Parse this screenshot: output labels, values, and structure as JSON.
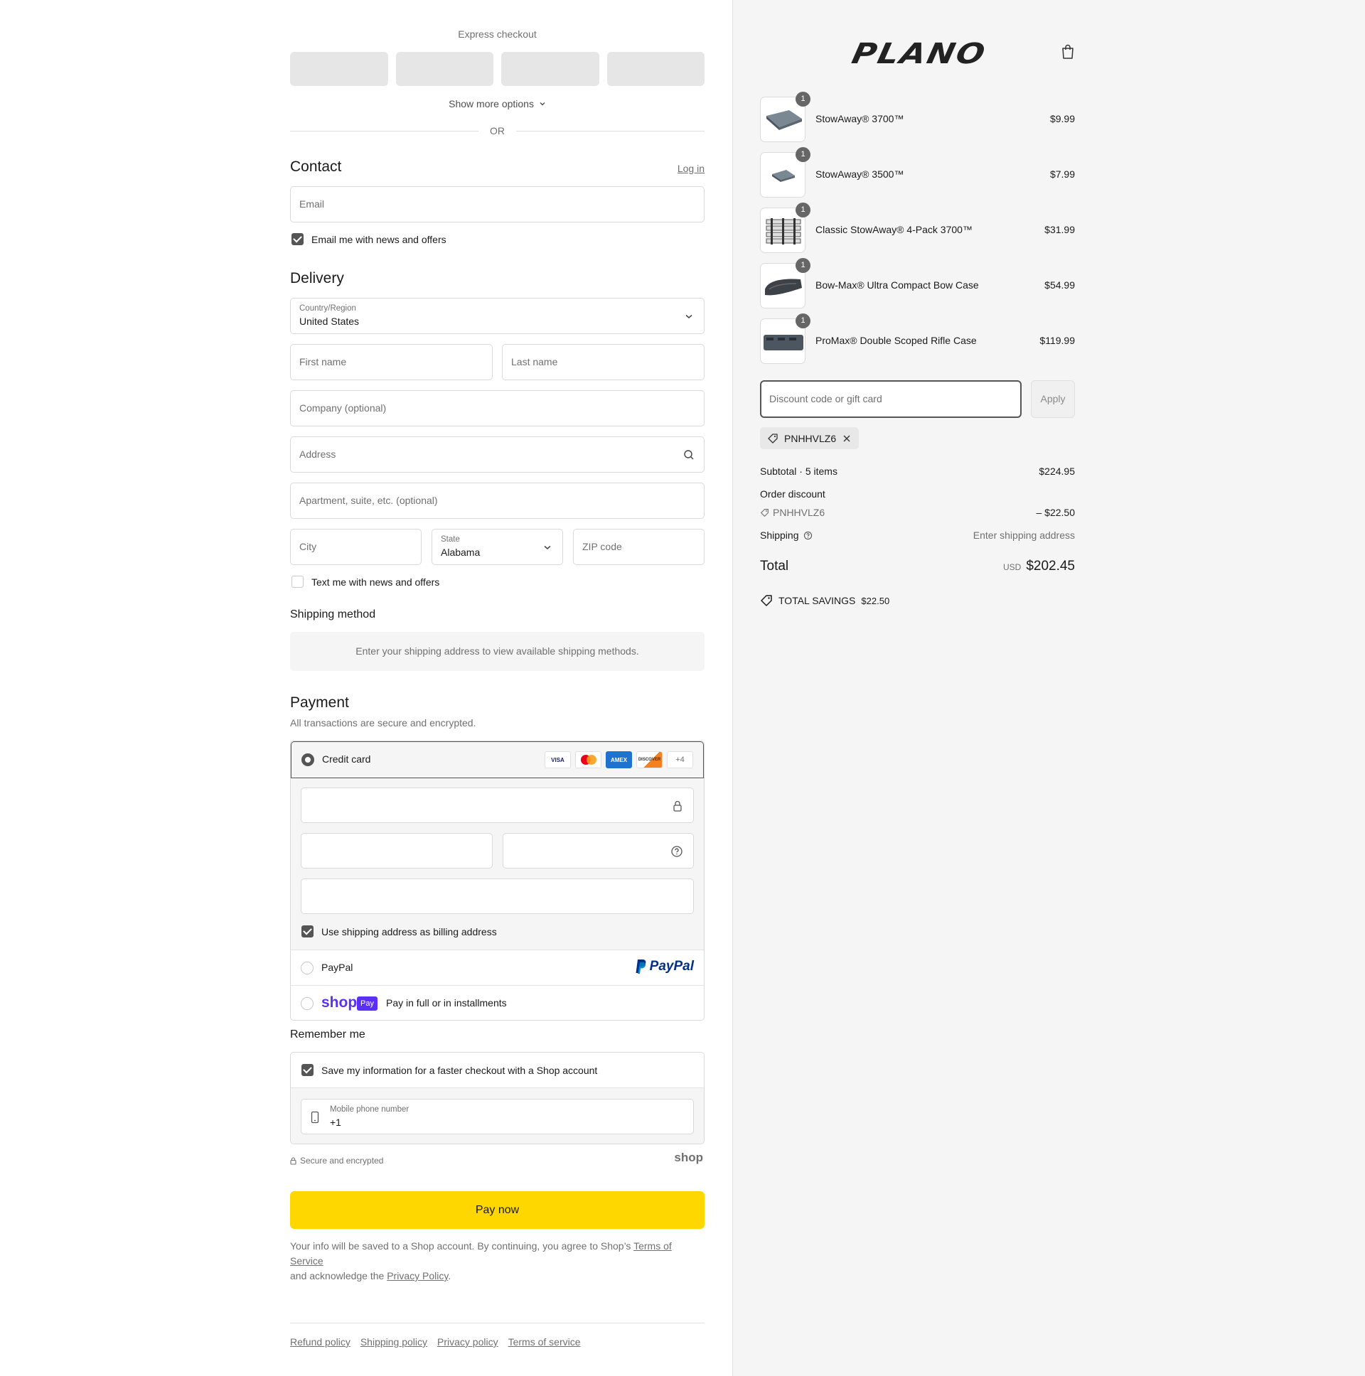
{
  "express": {
    "title": "Express checkout",
    "more_options": "Show more options",
    "or": "OR"
  },
  "contact": {
    "heading": "Contact",
    "login": "Log in",
    "email_placeholder": "Email",
    "news_label": "Email me with news and offers",
    "news_checked": true
  },
  "delivery": {
    "heading": "Delivery",
    "country_label": "Country/Region",
    "country_value": "United States",
    "first_name": "First name",
    "last_name": "Last name",
    "company": "Company (optional)",
    "address": "Address",
    "apartment": "Apartment, suite, etc. (optional)",
    "city": "City",
    "state_label": "State",
    "state_value": "Alabama",
    "zip": "ZIP code",
    "text_news": "Text me with news and offers"
  },
  "shipping_method": {
    "heading": "Shipping method",
    "info": "Enter your shipping address to view available shipping methods."
  },
  "payment": {
    "heading": "Payment",
    "subtitle": "All transactions are secure and encrypted.",
    "credit_card": "Credit card",
    "card_logos": [
      "VISA",
      "MC",
      "AMEX",
      "DISCOVER"
    ],
    "more_cards": "+4",
    "billing_same": "Use shipping address as billing address",
    "paypal": "PayPal",
    "paypal_logo": "PayPal",
    "shop_logo": "shop",
    "shop_pay_badge": "Pay",
    "shop_pay_text": "Pay in full or in installments"
  },
  "remember": {
    "heading": "Remember me",
    "save_label": "Save my information for a faster checkout with a Shop account",
    "phone_label": "Mobile phone number",
    "phone_value": "+1",
    "secure": "Secure and encrypted",
    "shop_brand": "shop"
  },
  "pay_now": "Pay now",
  "legal": {
    "text1": "Your info will be saved to a Shop account. By continuing, you agree to Shop’s ",
    "tos": "Terms of Service",
    "text2": "and acknowledge the ",
    "privacy": "Privacy Policy",
    "text3": "."
  },
  "footer": [
    "Refund policy",
    "Shipping policy",
    "Privacy policy",
    "Terms of service"
  ],
  "brand": "PLANO",
  "cart": {
    "items": [
      {
        "name": "StowAway® 3700™",
        "price": "$9.99",
        "qty": "1"
      },
      {
        "name": "StowAway® 3500™",
        "price": "$7.99",
        "qty": "1"
      },
      {
        "name": "Classic StowAway® 4-Pack 3700™",
        "price": "$31.99",
        "qty": "1"
      },
      {
        "name": "Bow-Max® Ultra Compact Bow Case",
        "price": "$54.99",
        "qty": "1"
      },
      {
        "name": "ProMax® Double Scoped Rifle Case",
        "price": "$119.99",
        "qty": "1"
      }
    ],
    "discount_placeholder": "Discount code or gift card",
    "apply": "Apply",
    "code": "PNHHVLZ6",
    "subtotal_label": "Subtotal · 5 items",
    "subtotal": "$224.95",
    "order_discount": "Order discount",
    "discount_amount": "– $22.50",
    "shipping_label": "Shipping",
    "shipping_value": "Enter shipping address",
    "total_label": "Total",
    "currency": "USD",
    "total": "$202.45",
    "savings_label": "TOTAL SAVINGS",
    "savings": "$22.50"
  },
  "colors": {
    "pay_button": "#ffd700",
    "shop_purple": "#5a31f4",
    "paypal_blue": "#003087"
  }
}
